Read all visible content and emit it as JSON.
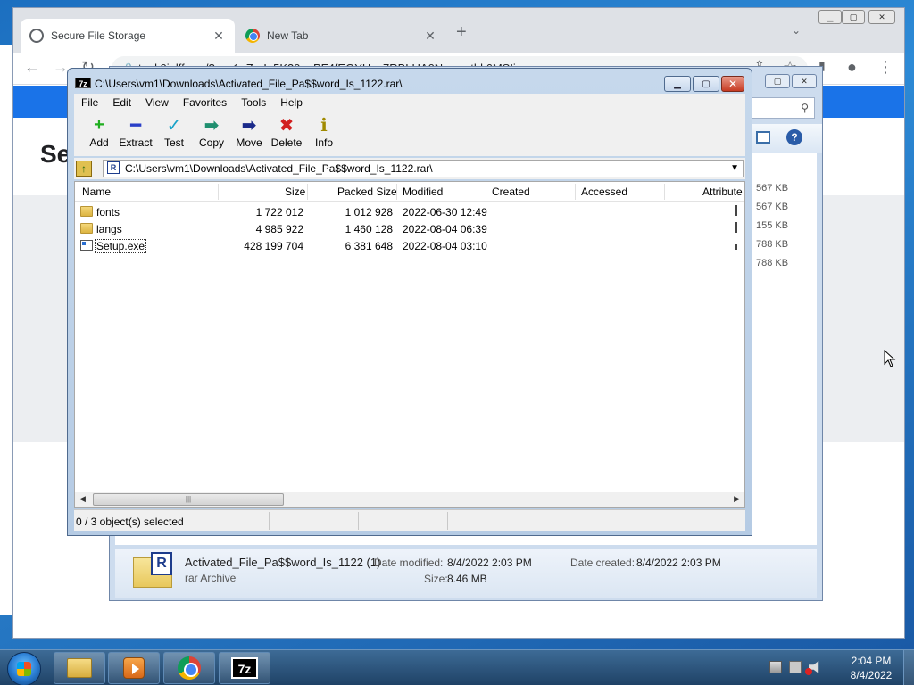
{
  "browser": {
    "tabs": [
      {
        "title": "Secure File Storage",
        "close": "✕"
      },
      {
        "title": "New Tab",
        "close": "✕"
      }
    ],
    "new_tab": "+",
    "tab_search": "⌄",
    "url": "teuk9iolff.xyz/?c=x1qZprIo5K39eaPF4fEQYHzq7RBLUA0Nmyvutbk6MSIi",
    "page_heading_partial": "Se",
    "controls": {
      "back": "←",
      "forward": "→",
      "reload": "↻",
      "share": "⇪",
      "star": "☆",
      "menu": "⋮",
      "profile": "●",
      "sidebar": "▮"
    }
  },
  "explorer": {
    "visible_sizes": [
      "567 KB",
      "567 KB",
      "155 KB",
      "788 KB",
      "788 KB"
    ],
    "details": {
      "name": "Activated_File_Pa$$word_Is_1122 (1)",
      "type": "rar Archive",
      "date_modified_label": "Date modified:",
      "date_modified": "8/4/2022 2:03 PM",
      "date_created_label": "Date created:",
      "date_created": "8/4/2022 2:03 PM",
      "size_label": "Size:",
      "size": "8.46 MB"
    }
  },
  "sevenzip": {
    "title": "C:\\Users\\vm1\\Downloads\\Activated_File_Pa$$word_Is_1122.rar\\",
    "logo": "7z",
    "menu": [
      "File",
      "Edit",
      "View",
      "Favorites",
      "Tools",
      "Help"
    ],
    "toolbar": [
      {
        "label": "Add",
        "icon": "+",
        "color": "#1fae1f"
      },
      {
        "label": "Extract",
        "icon": "━",
        "color": "#2a3fc8"
      },
      {
        "label": "Test",
        "icon": "✓",
        "color": "#17a2c8"
      },
      {
        "label": "Copy",
        "icon": "➡",
        "color": "#1f8f6f"
      },
      {
        "label": "Move",
        "icon": "➡",
        "color": "#1a2a8a"
      },
      {
        "label": "Delete",
        "icon": "✖",
        "color": "#d21e1e"
      },
      {
        "label": "Info",
        "icon": "ℹ",
        "color": "#a08a00"
      }
    ],
    "address": "C:\\Users\\vm1\\Downloads\\Activated_File_Pa$$word_Is_1122.rar\\",
    "columns": [
      "Name",
      "Size",
      "Packed Size",
      "Modified",
      "Created",
      "Accessed",
      "Attribute"
    ],
    "rows": [
      {
        "type": "folder",
        "name": "fonts",
        "size": "1 722 012",
        "packed": "1 012 928",
        "modified": "2022-06-30 12:49"
      },
      {
        "type": "folder",
        "name": "langs",
        "size": "4 985 922",
        "packed": "1 460 128",
        "modified": "2022-08-04 06:39"
      },
      {
        "type": "file",
        "name": "Setup.exe",
        "size": "428 199 704",
        "packed": "6 381 648",
        "modified": "2022-08-04 03:10"
      }
    ],
    "status": "0 / 3 object(s) selected"
  },
  "taskbar": {
    "seven_zip_label": "7z",
    "time": "2:04 PM",
    "date": "8/4/2022"
  }
}
